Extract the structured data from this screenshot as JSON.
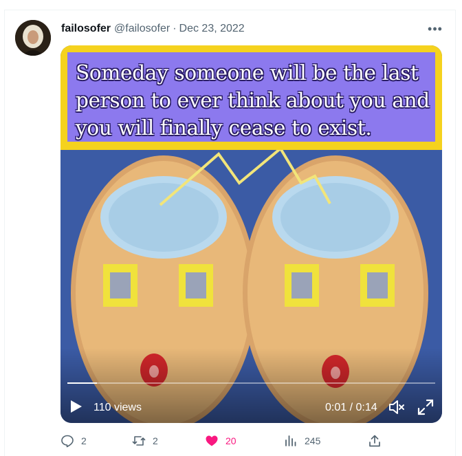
{
  "tweet": {
    "author_name": "failosofer",
    "author_handle": "@failosofer",
    "separator": "·",
    "date": "Dec 23, 2022",
    "more_icon": "more-horizontal-icon"
  },
  "media": {
    "caption": "Someday someone will be the last person to ever think about you and you will finally cease to exist.",
    "views": "110 views",
    "time": "0:01 / 0:14",
    "progress": 0.08,
    "caption_bg": "#8c79ee",
    "caption_border": "#f5d21e"
  },
  "actions": {
    "replies": "2",
    "retweets": "2",
    "likes": "20",
    "views": "245",
    "like_color": "#f91880"
  }
}
